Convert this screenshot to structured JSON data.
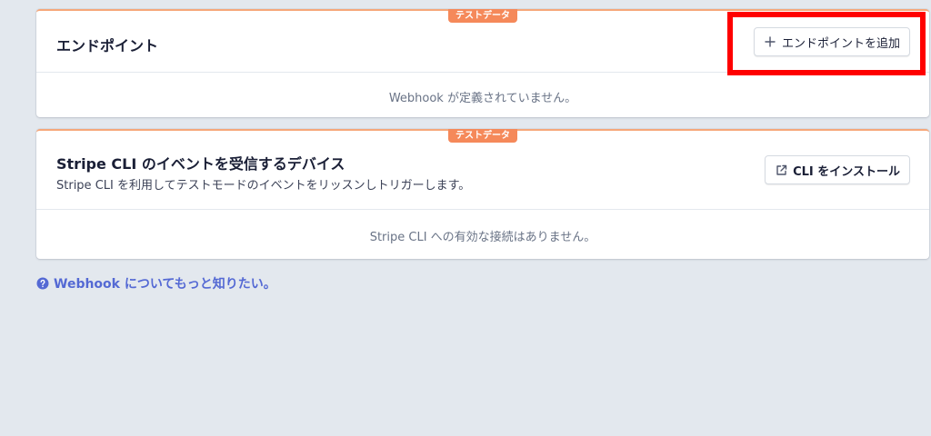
{
  "endpoints_card": {
    "badge": "テストデータ",
    "title": "エンドポイント",
    "add_button": {
      "icon": "plus-icon",
      "label": "エンドポイントを追加"
    },
    "empty_message": "Webhook が定義されていません。"
  },
  "cli_card": {
    "badge": "テストデータ",
    "title": "Stripe CLI のイベントを受信するデバイス",
    "subtitle": "Stripe CLI を利用してテストモードのイベントをリッスンしトリガーします。",
    "install_button": {
      "icon": "external-link-icon",
      "label": "CLI をインストール"
    },
    "empty_message": "Stripe CLI への有効な接続はありません。"
  },
  "help_link": {
    "icon": "question-circle-icon",
    "label": "Webhook についてもっと知りたい。"
  },
  "colors": {
    "background": "#e3e8ee",
    "badge": "#f5895a",
    "link": "#5469d4",
    "highlight": "#ff0000"
  }
}
